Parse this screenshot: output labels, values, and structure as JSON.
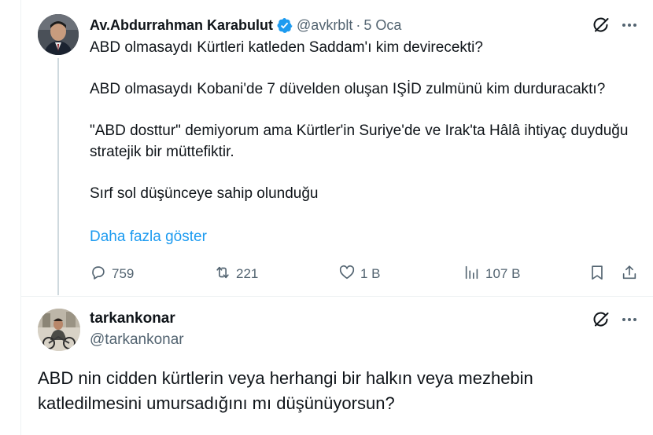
{
  "reply_parent": {
    "author": {
      "name": "Av.Abdurrahman Karabulut",
      "handle": "@avkrblt",
      "separator": "·",
      "time": "5 Oca",
      "verified": true
    },
    "paragraphs": [
      "ABD olmasaydı Kürtleri katleden Saddam'ı kim devirecekti?",
      "ABD olmasaydı Kobani'de 7 düvelden oluşan IŞİD zulmünü kim durduracaktı?",
      "\"ABD dosttur\" demiyorum ama Kürtler'in Suriye'de  ve Irak'ta Hâlâ ihtiyaç duyduğu stratejik bir müttefiktir.",
      "Sırf sol düşünceye sahip olunduğu"
    ],
    "show_more": "Daha fazla göster",
    "actions": {
      "replies": "759",
      "reposts": "221",
      "likes": "1 B",
      "views": "107 B"
    }
  },
  "reply": {
    "author": {
      "name": "tarkankonar",
      "handle": "@tarkankonar"
    },
    "text": "ABD nin cidden kürtlerin veya herhangi bir halkın veya mezhebin katledilmesini umursadığını mı düşünüyorsun?"
  },
  "icons": [
    "verified-badge-icon",
    "grok-icon",
    "more-icon",
    "reply-icon",
    "repost-icon",
    "like-icon",
    "views-icon",
    "bookmark-icon",
    "share-icon"
  ],
  "colors": {
    "accent": "#1d9bf0",
    "text": "#0f1419",
    "secondary": "#536471",
    "thread_line": "#cfd9de"
  }
}
